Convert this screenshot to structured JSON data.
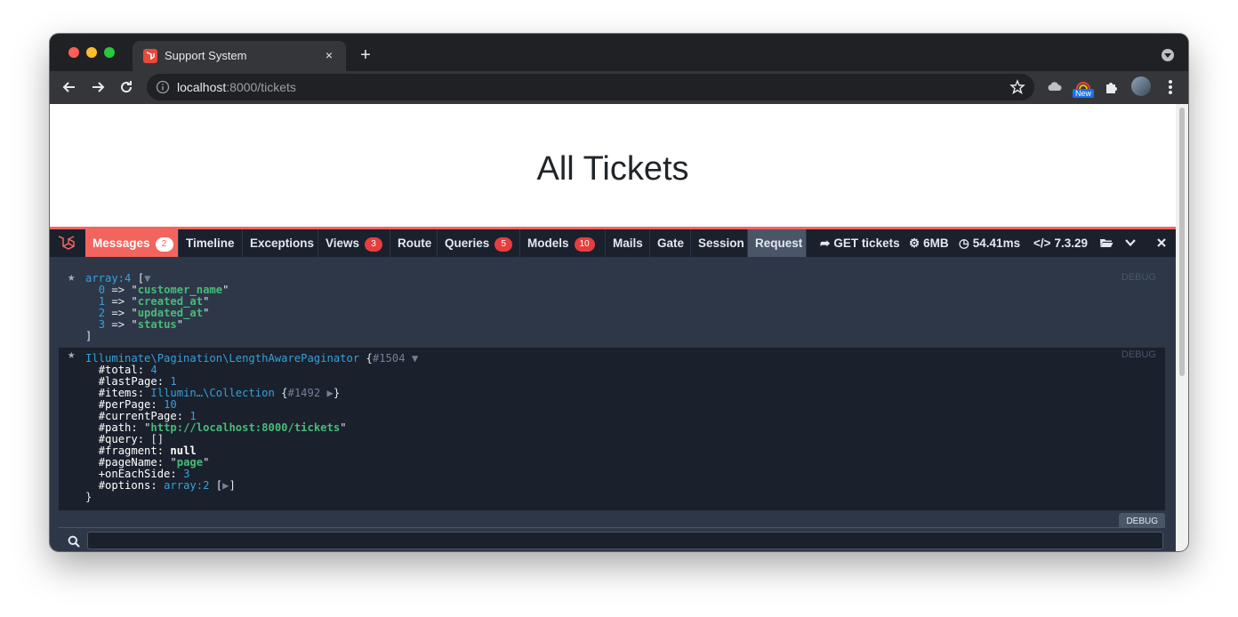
{
  "browser": {
    "tab_title": "Support System",
    "tab_close": "×",
    "new_tab": "+",
    "url_host": "localhost",
    "url_path": ":8000/tickets",
    "ext_new_badge": "New"
  },
  "page": {
    "heading": "All Tickets"
  },
  "debugbar": {
    "tabs": [
      {
        "label": "Messages",
        "badge": "2"
      },
      {
        "label": "Timeline"
      },
      {
        "label": "Exceptions"
      },
      {
        "label": "Views",
        "badge": "3"
      },
      {
        "label": "Route"
      },
      {
        "label": "Queries",
        "badge": "5"
      },
      {
        "label": "Models",
        "badge": "10"
      },
      {
        "label": "Mails"
      },
      {
        "label": "Gate"
      },
      {
        "label": "Session"
      },
      {
        "label": "Request"
      }
    ],
    "request_method": "GET tickets",
    "memory": "6MB",
    "time": "54.41ms",
    "php_version": "7.3.29",
    "colors": {
      "accent": "#f4645f",
      "bg": "#2d3748",
      "header": "#1a202c"
    }
  },
  "dump1": {
    "head": "array:4",
    "bracket_open": " [",
    "toggle": "▼",
    "items": [
      {
        "idx": "0",
        "val": "customer_name"
      },
      {
        "idx": "1",
        "val": "created_at"
      },
      {
        "idx": "2",
        "val": "updated_at"
      },
      {
        "idx": "3",
        "val": "status"
      }
    ],
    "bracket_close": "]",
    "tag": "DEBUG"
  },
  "dump2": {
    "class": "Illuminate\\Pagination\\LengthAwarePaginator",
    "ref": "#1504",
    "toggle": "▼",
    "total_key": "#total: ",
    "total": "4",
    "lastPage_key": "#lastPage: ",
    "lastPage": "1",
    "items_key": "#items: ",
    "items_class": "Illumin…\\Collection",
    "items_ref": "#1492",
    "perPage_key": "#perPage: ",
    "perPage": "10",
    "currentPage_key": "#currentPage: ",
    "currentPage": "1",
    "path_key": "#path: ",
    "path": "http://localhost:8000/tickets",
    "query_key": "#query: ",
    "query": "[]",
    "fragment_key": "#fragment: ",
    "fragment": "null",
    "pageName_key": "#pageName: ",
    "pageName": "page",
    "onEachSide_key": "+onEachSide: ",
    "onEachSide": "3",
    "options_key": "#options: ",
    "options": "array:2",
    "tag": "DEBUG",
    "debug_button": "DEBUG"
  }
}
